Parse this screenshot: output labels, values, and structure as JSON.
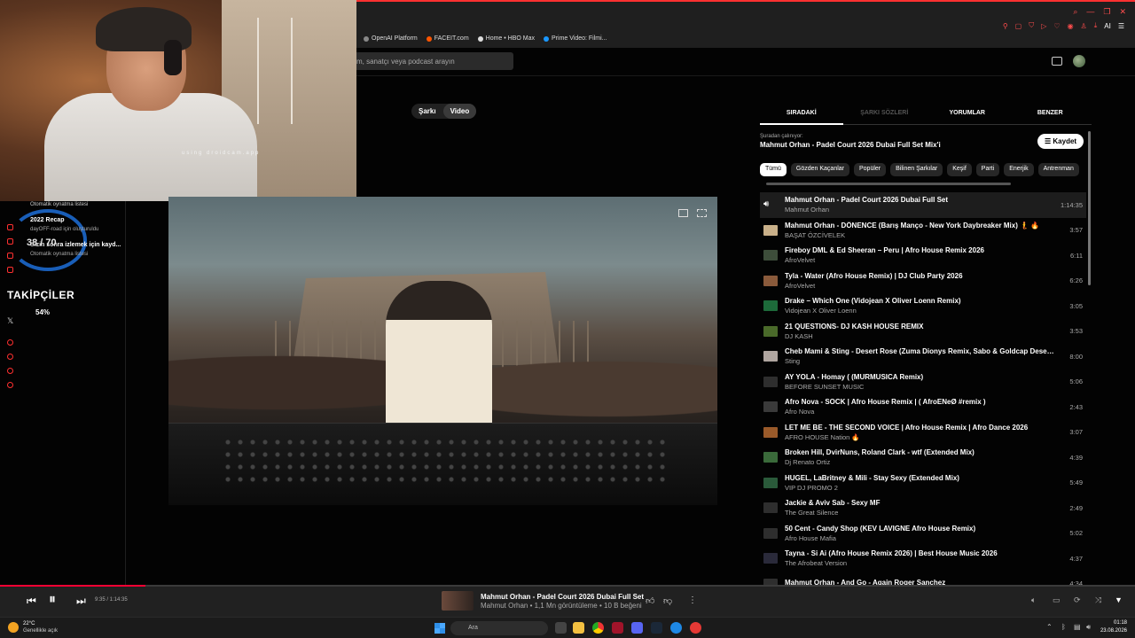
{
  "browser": {
    "bookmarks": [
      "OpenAI Platform",
      "FACEIT.com",
      "Home • HBO Max",
      "Prime Video: Filmi..."
    ],
    "ai_label": "AI"
  },
  "header": {
    "search_placeholder": "m, sanatçı veya podcast arayın"
  },
  "webcam": {
    "watermark": "using droidcam.app"
  },
  "sidebar": {
    "autoplay_list": "Otomatik oynatma listesi",
    "recap_title": "2022 Recap",
    "recap_sub": "dayOFF-road için oluşturuldu",
    "recap2_title": "Sizin sonra izlemek için kayd...",
    "recap2_sub": "Otomatik oynatma listesi",
    "counter": "38 / 70",
    "followers_label": "TAKİPÇİLER",
    "percent": "54%",
    "x_icon": "𝕏"
  },
  "mode_switch": {
    "song": "Şarkı",
    "video": "Video"
  },
  "right_panel": {
    "tabs": [
      "SIRADAKİ",
      "ŞARKI SÖZLERİ",
      "YORUMLAR",
      "BENZER"
    ],
    "playing_from_label": "Şuradan çalınıyor:",
    "playlist_name": "Mahmut Orhan - Padel Court 2026 Dubai Full Set Mix'i",
    "save_label": "Kaydet",
    "chips": [
      "Tümü",
      "Gözden Kaçanlar",
      "Popüler",
      "Bilinen Şarkılar",
      "Keşif",
      "Parti",
      "Enerjik",
      "Antrenman"
    ]
  },
  "queue": [
    {
      "title": "Mahmut Orhan - Padel Court 2026 Dubai Full Set",
      "artist": "Mahmut Orhan",
      "duration": "1:14:35",
      "now": true,
      "color": "#5a3a2a"
    },
    {
      "title": "Mahmut Orhan - DÖNENCE (Barış Manço - New York Daybreaker Mix) 🧜 🔥",
      "artist": "BAŞAT ÖZCİVELEK",
      "duration": "3:57",
      "color": "#c9b089"
    },
    {
      "title": "Fireboy DML & Ed Sheeran – Peru | Afro House Remix 2026",
      "artist": "AfroVelvet",
      "duration": "6:11",
      "color": "#3d4d3a"
    },
    {
      "title": "Tyla - Water (Afro House Remix) | DJ Club Party 2026",
      "artist": "AfroVelvet",
      "duration": "6:26",
      "color": "#8a5a3b"
    },
    {
      "title": "Drake – Which One (Vidojean X Oliver Loenn Remix)",
      "artist": "Vidojean X Oliver Loenn",
      "duration": "3:05",
      "color": "#1d6b3a"
    },
    {
      "title": "21 QUESTIONS- DJ KASH HOUSE REMIX",
      "artist": "DJ KASH",
      "duration": "3:53",
      "color": "#4a6a2a"
    },
    {
      "title": "Cheb Mami & Sting - Desert Rose (Zuma Dionys Remix, Sabo & Goldcap Desert Sunri...",
      "artist": "Sting",
      "duration": "8:00",
      "color": "#b0a6a0"
    },
    {
      "title": "AY YOLA - Homay ( (MURMUSICA Remix)",
      "artist": "BEFORE SUNSET MUSIC",
      "duration": "5:06",
      "color": "#2e2e2e"
    },
    {
      "title": "Afro Nova - SOCK | Afro House Remix | ( AfroENeØ #remix )",
      "artist": "Afro Nova",
      "duration": "2:43",
      "color": "#3a3a3a"
    },
    {
      "title": "LET ME BE - THE SECOND VOICE | Afro House Remix | Afro Dance 2026",
      "artist": "AFRO HOUSE Nation 🔥",
      "duration": "3:07",
      "color": "#9a5a2a"
    },
    {
      "title": "Broken Hill, DvirNuns, Roland Clark - wtf (Extended Mix)",
      "artist": "Dj Renato Ortiz",
      "duration": "4:39",
      "color": "#3a6a3a"
    },
    {
      "title": "HUGEL, LaBritney & Mili - Stay Sexy (Extended Mix)",
      "artist": "VIP DJ PROMO 2",
      "duration": "5:49",
      "color": "#2a5a3a"
    },
    {
      "title": "Jackie & Aviv Sab - Sexy MF",
      "artist": "The Great Silence",
      "duration": "2:49",
      "color": "#2e2e2e"
    },
    {
      "title": "50 Cent - Candy Shop (KEV LAVIGNE Afro House Remix)",
      "artist": "Afro House Mafia",
      "duration": "5:02",
      "color": "#2e2e2e"
    },
    {
      "title": "Tayna - Si Ai (Afro House Remix 2026) | Best House Music 2026",
      "artist": "The Afrobeat Version",
      "duration": "4:37",
      "color": "#2a2a3a"
    },
    {
      "title": "Mahmut Orhan - And Go - Again Roger Sanchez",
      "artist": "",
      "duration": "4:34",
      "color": "#2e2e2e"
    }
  ],
  "player": {
    "time": "9:35 / 1:14:35",
    "progress": 0.1285,
    "title": "Mahmut Orhan - Padel Court 2026 Dubai Full Set",
    "subtitle": "Mahmut Orhan • 1,1 Mn görüntüleme • 10 B beğeni"
  },
  "taskbar": {
    "temp": "22°C",
    "weather": "Genellikle açık",
    "search": "Ara",
    "time": "01:18",
    "date": "23.08.2026"
  },
  "colors": {
    "accent": "#ff0033",
    "sidebar_icon": "#ff3030",
    "ring": "#1e6fd8"
  }
}
